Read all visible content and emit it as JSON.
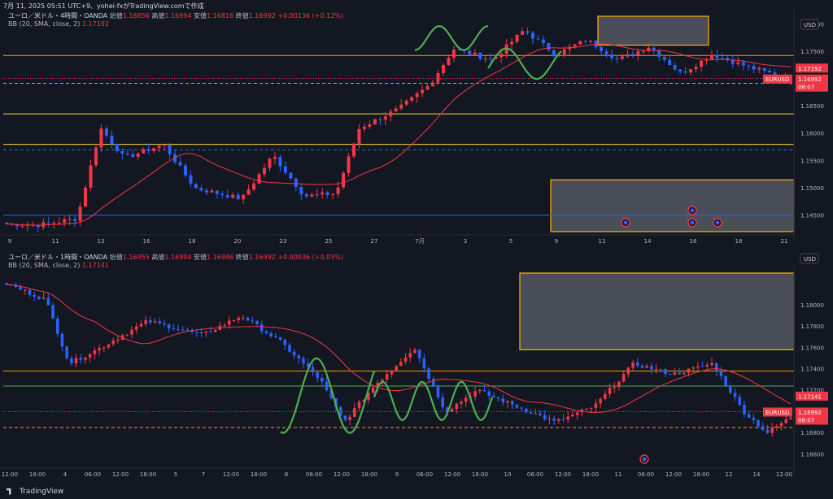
{
  "header": {
    "text": "7月 11, 2025 05:51 UTC+9、yohei-fxがTradingView.comで作成"
  },
  "footer": {
    "brand": "TradingView"
  },
  "colors": {
    "bg": "#131722",
    "up": "#f23645",
    "down": "#2962ff",
    "bb": "#f23645",
    "orange": "#ff9800",
    "yellow": "#fdd835",
    "blue": "#2962ff",
    "green": "#4caf50",
    "drawing": "#4caf50"
  },
  "panes": [
    {
      "legend": {
        "prefix": "ユーロ／米ドル・4時間・OANDA",
        "o_label": "始値",
        "o": "1.16856",
        "h_label": "高値",
        "h": "1.16994",
        "l_label": "安値",
        "l": "1.16816",
        "c_label": "終値",
        "c": "1.16992",
        "chg": "+0.00136 (+0.12%)",
        "bb_label": "BB (20, SMA, close, 2)",
        "bb_value": "1.17192"
      },
      "currency": "USD",
      "badge_symbol": "EURUSD",
      "badge_price": "1.16992",
      "badge_time": "08:07",
      "bb_price": "1.17192",
      "price_ticks": [
        "1.18000",
        "1.17500",
        "1.17000",
        "1.16500",
        "1.16000",
        "1.15500",
        "1.15000",
        "1.14500"
      ],
      "time_ticks": [
        "9",
        "11",
        "13",
        "16",
        "18",
        "20",
        "23",
        "25",
        "27",
        "7月",
        "3",
        "5",
        "9",
        "11",
        "14",
        "16",
        "18",
        "21"
      ]
    },
    {
      "legend": {
        "prefix": "ユーロ／米ドル・1時間・OANDA",
        "o_label": "始値",
        "o": "1.16955",
        "h_label": "高値",
        "h": "1.16994",
        "l_label": "安値",
        "l": "1.16946",
        "c_label": "終値",
        "c": "1.16992",
        "chg": "+0.00036 (+0.03%)",
        "bb_label": "BB (20, SMA, close, 2)",
        "bb_value": "1.17141"
      },
      "currency": "USD",
      "badge_symbol": "EURUSD",
      "badge_price": "1.16992",
      "badge_time": "08:07",
      "bb_price": "1.17141",
      "price_ticks": [
        "1.18000",
        "1.17800",
        "1.17600",
        "1.17400",
        "1.17200",
        "1.17000",
        "1.16800",
        "1.16600"
      ],
      "time_ticks": [
        "12:00",
        "18:00",
        "4",
        "06:00",
        "12:00",
        "18:00",
        "5",
        "7",
        "12:00",
        "18:00",
        "8",
        "06:00",
        "12:00",
        "18:00",
        "9",
        "06:00",
        "12:00",
        "18:00",
        "10",
        "06:00",
        "12:00",
        "18:00",
        "11",
        "06:00",
        "12:00",
        "18:00",
        "12",
        "14",
        "12:00"
      ]
    }
  ],
  "chart_data": [
    {
      "type": "candlestick",
      "symbol": "EURUSD",
      "interval": "4H",
      "price_range": [
        1.142,
        1.1815
      ],
      "indicator": "BB (20, SMA, close, 2) basis",
      "ohlc_source": "estimated from screenshot",
      "horizontal_levels": [
        {
          "price": 1.1743,
          "color": "orange",
          "style": "solid"
        },
        {
          "price": 1.1701,
          "color": "red",
          "style": "dotted"
        },
        {
          "price": 1.1692,
          "color": "orange",
          "style": "dashed"
        },
        {
          "price": 1.1636,
          "color": "yellow",
          "style": "solid"
        },
        {
          "price": 1.158,
          "color": "yellow",
          "style": "solid"
        },
        {
          "price": 1.157,
          "color": "blue",
          "style": "dashed"
        },
        {
          "price": 1.145,
          "color": "blue",
          "style": "solid"
        }
      ],
      "zones": [
        {
          "label": "upper box",
          "price_top": 1.1815,
          "price_bottom": 1.1762
        },
        {
          "label": "lower box",
          "price_top": 1.1515,
          "price_bottom": 1.142
        }
      ]
    },
    {
      "type": "candlestick",
      "symbol": "EURUSD",
      "interval": "1H",
      "price_range": [
        1.165,
        1.183
      ],
      "indicator": "BB (20, SMA, close, 2) basis",
      "ohlc_source": "estimated from screenshot",
      "horizontal_levels": [
        {
          "price": 1.1738,
          "color": "orange",
          "style": "solid"
        },
        {
          "price": 1.1724,
          "color": "green",
          "style": "solid"
        },
        {
          "price": 1.17,
          "color": "red",
          "style": "dotted"
        },
        {
          "price": 1.1685,
          "color": "orange",
          "style": "dashed"
        }
      ],
      "zones": [
        {
          "label": "upper box",
          "price_top": 1.183,
          "price_bottom": 1.1758
        }
      ]
    }
  ]
}
